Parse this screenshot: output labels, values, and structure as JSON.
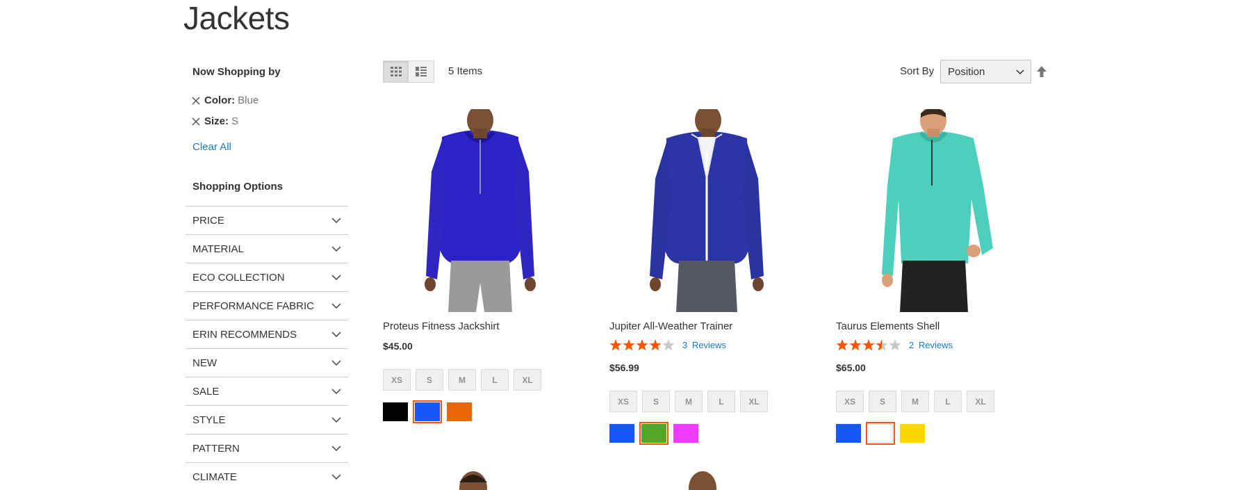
{
  "page": {
    "title": "Jackets"
  },
  "sidebar": {
    "now_shopping_title": "Now Shopping by",
    "filters": [
      {
        "label": "Color:",
        "value": "Blue"
      },
      {
        "label": "Size:",
        "value": "S"
      }
    ],
    "clear_all": "Clear All",
    "shopping_options_title": "Shopping Options",
    "options": [
      "PRICE",
      "MATERIAL",
      "ECO COLLECTION",
      "PERFORMANCE FABRIC",
      "ERIN RECOMMENDS",
      "NEW",
      "SALE",
      "STYLE",
      "PATTERN",
      "CLIMATE"
    ]
  },
  "toolbar": {
    "items_count": "5 Items",
    "sort_label": "Sort By",
    "sort_value": "Position",
    "view_modes": [
      "grid-icon",
      "list-icon"
    ]
  },
  "products": [
    {
      "name": "Proteus Fitness Jackshirt",
      "price": "$45.00",
      "sizes": [
        "XS",
        "S",
        "M",
        "L",
        "XL"
      ],
      "swatches": [
        "#000000",
        "#1857f7",
        "#eb6703"
      ],
      "selected_swatch": 1,
      "shirt_color": "#2b22c8"
    },
    {
      "name": "Jupiter All-Weather Trainer",
      "rating_stars": 4,
      "reviews_count": "3",
      "reviews_label": "Reviews",
      "price": "$56.99",
      "sizes": [
        "XS",
        "S",
        "M",
        "L",
        "XL"
      ],
      "swatches": [
        "#1857f7",
        "#53a828",
        "#ef3dff"
      ],
      "selected_swatch": 1,
      "shirt_color": "#2c35a6"
    },
    {
      "name": "Taurus Elements Shell",
      "rating_stars": 3.5,
      "reviews_count": "2",
      "reviews_label": "Reviews",
      "price": "$65.00",
      "sizes": [
        "XS",
        "S",
        "M",
        "L",
        "XL"
      ],
      "swatches": [
        "#1857f7",
        "#ffffff",
        "#ffd500"
      ],
      "selected_swatch": 1,
      "shirt_color": "#4ccfbb"
    }
  ],
  "colors": {
    "accent_link": "#1979c3",
    "star": "#ff5501",
    "star_empty": "#c7c7c7"
  }
}
